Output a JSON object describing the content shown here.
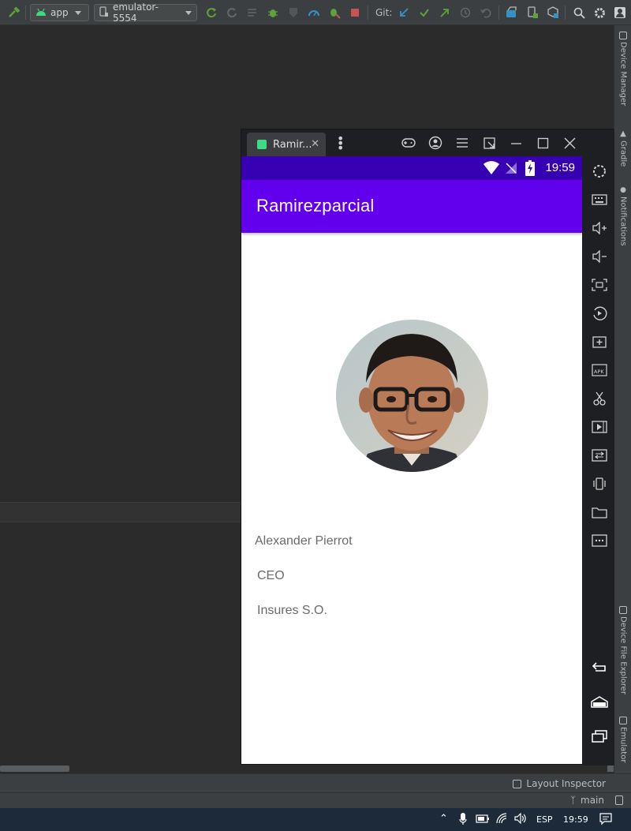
{
  "toolbar": {
    "run_config": "app",
    "device": "emulator-5554",
    "git_label": "Git:"
  },
  "right_strip": {
    "tabs": [
      "Device Manager",
      "Gradle",
      "Notifications",
      "Device File Explorer",
      "Emulator"
    ]
  },
  "emulator": {
    "tab_title": "Ramir...",
    "status_time": "19:59",
    "app_title": "Ramirezparcial",
    "profile": {
      "name": "Alexander Pierrot",
      "position": "CEO",
      "company": "Insures S.O."
    }
  },
  "status": {
    "layout_inspector": "Layout Inspector",
    "branch": "main"
  },
  "taskbar": {
    "language": "ESP",
    "time": "19:59"
  },
  "colors": {
    "status_bar": "#3700b3",
    "app_bar": "#6200ee",
    "ide_background": "#2b2b2b",
    "ide_toolbar": "#3c3f41",
    "android_green": "#3ddc84"
  }
}
